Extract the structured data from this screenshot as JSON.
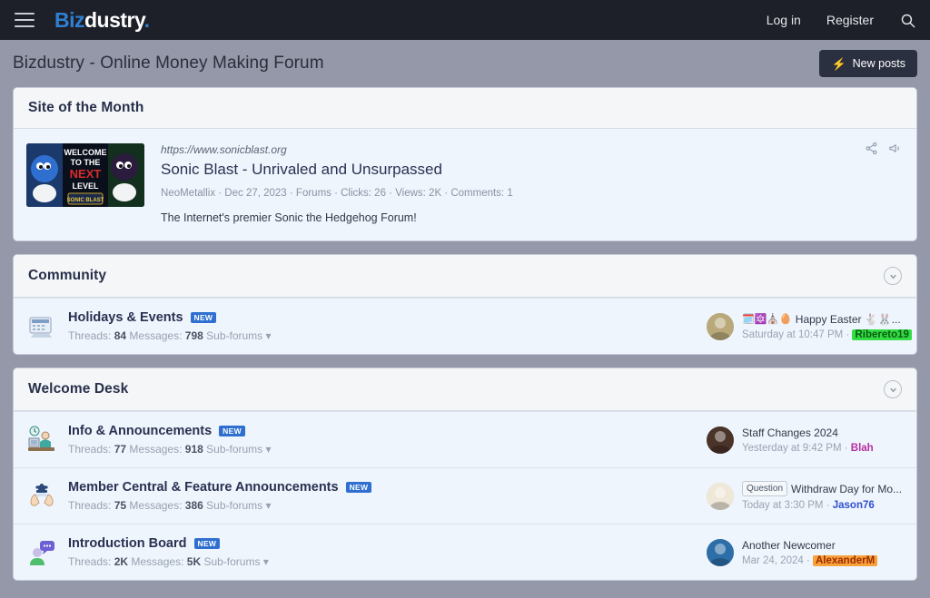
{
  "topnav": {
    "menu_icon": "hamburger-icon",
    "logo_part1": "Biz",
    "logo_part2": "dustry",
    "logo_dot": ".",
    "login_label": "Log in",
    "register_label": "Register",
    "search_icon": "search-icon"
  },
  "titlebar": {
    "title": "Bizdustry - Online Money Making Forum",
    "new_posts_label": "New posts",
    "new_posts_icon": "lightning-bolt-icon"
  },
  "site_of_the_month": {
    "header": "Site of the Month",
    "url": "https://www.sonicblast.org",
    "name": "Sonic Blast - Unrivaled and Unsurpassed",
    "meta": "NeoMetallix · Dec 27, 2023 · Forums · Clicks: 26 · Views: 2K · Comments: 1",
    "description": "The Internet's premier Sonic the Hedgehog Forum!",
    "thumbnail_text_1": "WELCOME",
    "thumbnail_text_2": "TO THE",
    "thumbnail_text_3": "NEXT",
    "thumbnail_text_4": "LEVEL",
    "share_icon": "share-icon",
    "announce_icon": "megaphone-icon"
  },
  "categories": [
    {
      "header": "Community",
      "collapse_icon": "chevron-down-circle-icon",
      "forums": [
        {
          "icon": "calendar-monitor-icon",
          "title": "Holidays & Events",
          "badge": "NEW",
          "threads_label": "Threads:",
          "threads_value": "84",
          "messages_label": "Messages:",
          "messages_value": "798",
          "subforums_label": "Sub-forums",
          "last_post_emoji_pre": "🗓️🔯⛪🥚",
          "last_post_title": "Happy Easter 🐇🐰...",
          "last_post_date": "Saturday at 10:47 PM",
          "last_post_user": "Ribereto19",
          "user_class": "ribereto",
          "avatar_color": "#b9a97a",
          "prefix": ""
        }
      ]
    },
    {
      "header": "Welcome Desk",
      "collapse_icon": "chevron-down-circle-icon",
      "forums": [
        {
          "icon": "desk-clock-icon",
          "title": "Info & Announcements",
          "badge": "NEW",
          "threads_label": "Threads:",
          "threads_value": "77",
          "messages_label": "Messages:",
          "messages_value": "918",
          "subforums_label": "Sub-forums",
          "last_post_emoji_pre": "",
          "last_post_title": "Staff Changes 2024",
          "last_post_date": "Yesterday at 9:42 PM",
          "last_post_user": "Blah",
          "user_class": "blah",
          "avatar_color": "#4a3328",
          "prefix": ""
        },
        {
          "icon": "hands-gear-icon",
          "title": "Member Central & Feature Announcements",
          "badge": "NEW",
          "threads_label": "Threads:",
          "threads_value": "75",
          "messages_label": "Messages:",
          "messages_value": "386",
          "subforums_label": "Sub-forums",
          "last_post_emoji_pre": "",
          "last_post_title": "Withdraw Day for Mo...",
          "last_post_date": "Today at 3:30 PM",
          "last_post_user": "Jason76",
          "user_class": "jason",
          "avatar_color": "#efe7d8",
          "prefix": "Question"
        },
        {
          "icon": "person-speech-icon",
          "title": "Introduction Board",
          "badge": "NEW",
          "threads_label": "Threads:",
          "threads_value": "2K",
          "messages_label": "Messages:",
          "messages_value": "5K",
          "subforums_label": "Sub-forums",
          "last_post_emoji_pre": "",
          "last_post_title": "Another Newcomer",
          "last_post_date": "Mar 24, 2024",
          "last_post_user": "AlexanderM",
          "user_class": "alex",
          "avatar_color": "#2d6ea8",
          "prefix": ""
        }
      ]
    }
  ],
  "colors": {
    "nav_bg": "#1d2029",
    "page_bg": "#9498a8",
    "block_bg": "#eef5fd",
    "accent_blue": "#2f6fd0",
    "logo_blue": "#2f7fd4"
  }
}
